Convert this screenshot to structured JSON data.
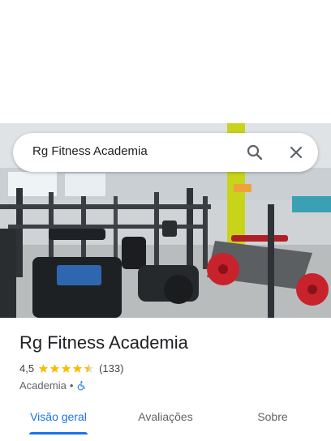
{
  "search": {
    "query": "Rg Fitness Academia"
  },
  "place": {
    "title": "Rg Fitness Academia",
    "rating": "4,5",
    "stars": 4.5,
    "review_count": "(133)",
    "category": "Academia",
    "separator": "•"
  },
  "tabs": [
    {
      "label": "Visão geral",
      "active": true
    },
    {
      "label": "Avaliações",
      "active": false
    },
    {
      "label": "Sobre",
      "active": false
    }
  ],
  "icons": {
    "search": "search-icon",
    "close": "close-icon",
    "star": "star-icon",
    "accessibility": "wheelchair-icon"
  },
  "colors": {
    "accent": "#1a73e8",
    "star": "#fbbc04",
    "text_primary": "#202124",
    "text_secondary": "#5f6368"
  }
}
